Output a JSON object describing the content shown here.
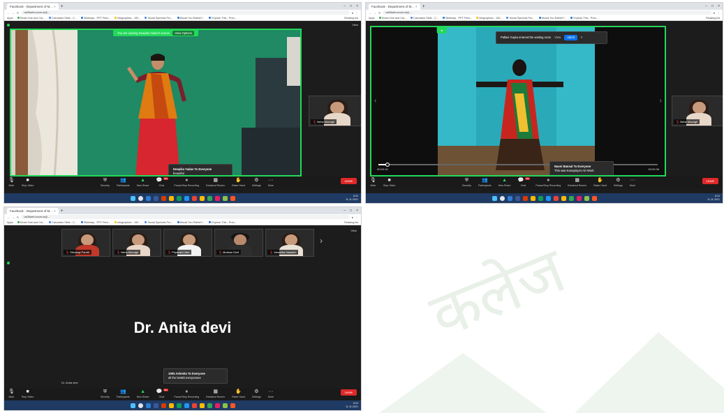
{
  "screens": {
    "top_left": {
      "browser": {
        "tab_title": "Facebook - Department of M...",
        "url": "us06web.zoom.us/j/...",
        "bookmarks": [
          "Apps",
          "Smart Hub and Cla...",
          "Calculator Slide - C...",
          "Slideway - PPT Flexi...",
          "infographics - 100...",
          "Social Symbols Pro...",
          "Would You Rather?...",
          "Explore This - Pres..."
        ],
        "reading_list": "Reading list"
      },
      "zoom": {
        "banner": "You are viewing Deepika Yadav's screen",
        "view_options": "View Options",
        "view_label": "View",
        "thumbnail_name": "Neha Moudgil",
        "toast_from": "Deepika Yadav To Everyone",
        "toast_msg": "beautiful"
      }
    },
    "top_right": {
      "browser": {
        "tab_title": "Facebook - Department of M...",
        "url": "us06web.zoom.us/j/...",
        "bookmarks": [
          "Apps",
          "Smart Hub and Cla...",
          "Calculator Slide - C...",
          "Slideway - PPT Flexi...",
          "infographics - 100...",
          "Social Symbols Pro...",
          "Would You Rather?...",
          "Explore This - Pres..."
        ],
        "reading_list": "Reading list"
      },
      "zoom": {
        "notification": "Pallavi Gupta entered the waiting room",
        "view_btn": "View",
        "admit_btn": "Admit",
        "thumbnail_name": "Neha Moudgil",
        "toast_from": "Navni Bansal To Everyone",
        "toast_msg": "This was Kanupriya's Art Work",
        "time_left": "00:00:16",
        "time_right": "00:00:36"
      }
    },
    "bottom_left": {
      "browser": {
        "tab_title": "Facebook - Department of M...",
        "url": "us06web.zoom.us/j/...",
        "bookmarks": [
          "Apps",
          "Smart Hub and Cla...",
          "Calculator Slide - C...",
          "Slideway - PPT Flexi...",
          "infographics - 100...",
          "Social Symbols Pro...",
          "Would You Rather?...",
          "Explore This - Pres..."
        ],
        "reading_list": "Reading list"
      },
      "zoom": {
        "gallery": [
          {
            "name": "Shivangi Pandit",
            "shirt": "#c0392b"
          },
          {
            "name": "Neha Moudgil",
            "shirt": "#e8d6c8"
          },
          {
            "name": "Priyanshi Jain",
            "shirt": "#f2f2f2"
          },
          {
            "name": "Muskan Dixit",
            "shirt": "#2e2e2e"
          },
          {
            "name": "Vanshika Vasanth",
            "shirt": "#e9e1d6"
          }
        ],
        "speaker": "Dr. Anita devi",
        "speaker_label": "Dr. Anita devi",
        "toast_from": "1093 Ashmita To Everyone",
        "toast_msg": "all the bestttt everyoneee",
        "view_label": "View"
      }
    }
  },
  "toolbar": {
    "items": [
      {
        "label": "Mute",
        "icon": "microphone-icon"
      },
      {
        "label": "Stop Video",
        "icon": "video-camera-icon"
      },
      {
        "label": "Security",
        "icon": "shield-icon"
      },
      {
        "label": "Participants",
        "icon": "participants-icon"
      },
      {
        "label": "New Share",
        "icon": "share-screen-icon"
      },
      {
        "label": "Chat",
        "icon": "chat-icon"
      },
      {
        "label": "Pause/Stop Recording",
        "icon": "record-icon"
      },
      {
        "label": "Breakout Rooms",
        "icon": "breakout-rooms-icon"
      },
      {
        "label": "Raise Hand",
        "icon": "raise-hand-icon"
      },
      {
        "label": "Settings",
        "icon": "gear-icon"
      },
      {
        "label": "More",
        "icon": "more-icon"
      }
    ],
    "leave": "Leave",
    "chat_badge": "99+"
  },
  "taskbar": {
    "time": "8:24",
    "date": "11-11-2021",
    "lang": "ENG IN"
  },
  "watermark": "कलेज"
}
